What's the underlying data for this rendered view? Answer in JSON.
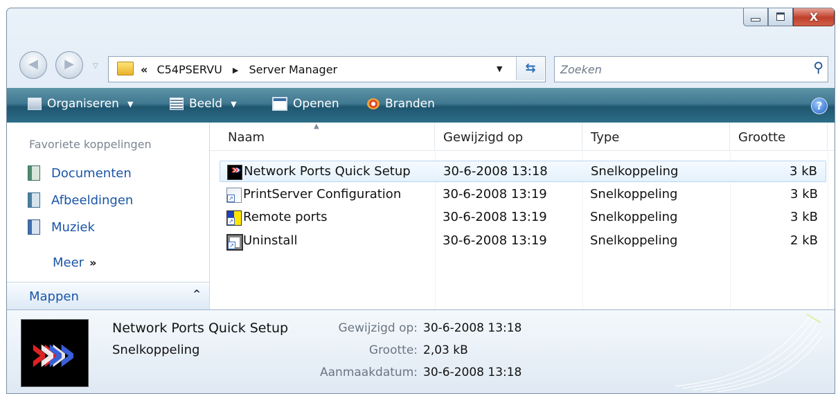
{
  "window": {
    "caption_buttons": [
      "minimize",
      "maximize",
      "close"
    ]
  },
  "nav": {
    "back_icon": "back-arrow-icon",
    "forward_icon": "forward-arrow-icon"
  },
  "address": {
    "overflow": "«",
    "crumb1": "C54PSERVU",
    "crumb2": "Server Manager"
  },
  "search": {
    "placeholder": "Zoeken"
  },
  "toolbar": {
    "organize": "Organiseren",
    "view": "Beeld",
    "open": "Openen",
    "burn": "Branden",
    "help": "?"
  },
  "sidebar": {
    "favorites_title": "Favoriete koppelingen",
    "items": [
      {
        "label": "Documenten",
        "icon": "documents-library-icon"
      },
      {
        "label": "Afbeeldingen",
        "icon": "pictures-library-icon"
      },
      {
        "label": "Muziek",
        "icon": "music-library-icon"
      }
    ],
    "more": "Meer",
    "more_glyph": "»",
    "folders": "Mappen",
    "folders_glyph": "^"
  },
  "columns": [
    "Naam",
    "Gewijzigd op",
    "Type",
    "Grootte"
  ],
  "files": [
    {
      "name": "Network Ports Quick Setup",
      "modified": "30-6-2008 13:18",
      "type": "Snelkoppeling",
      "size": "3 kB",
      "selected": true
    },
    {
      "name": "PrintServer Configuration",
      "modified": "30-6-2008 13:19",
      "type": "Snelkoppeling",
      "size": "3 kB",
      "selected": false
    },
    {
      "name": "Remote ports",
      "modified": "30-6-2008 13:19",
      "type": "Snelkoppeling",
      "size": "3 kB",
      "selected": false
    },
    {
      "name": "Uninstall",
      "modified": "30-6-2008 13:19",
      "type": "Snelkoppeling",
      "size": "2 kB",
      "selected": false
    }
  ],
  "details": {
    "name": "Network Ports Quick Setup",
    "type": "Snelkoppeling",
    "modified_label": "Gewijzigd op:",
    "modified_value": "30-6-2008 13:18",
    "size_label": "Grootte:",
    "size_value": "2,03 kB",
    "created_label": "Aanmaakdatum:",
    "created_value": "30-6-2008 13:18"
  },
  "colors": {
    "toolbar": "#2c6d86",
    "link": "#1a55a6",
    "close": "#c1402b"
  }
}
